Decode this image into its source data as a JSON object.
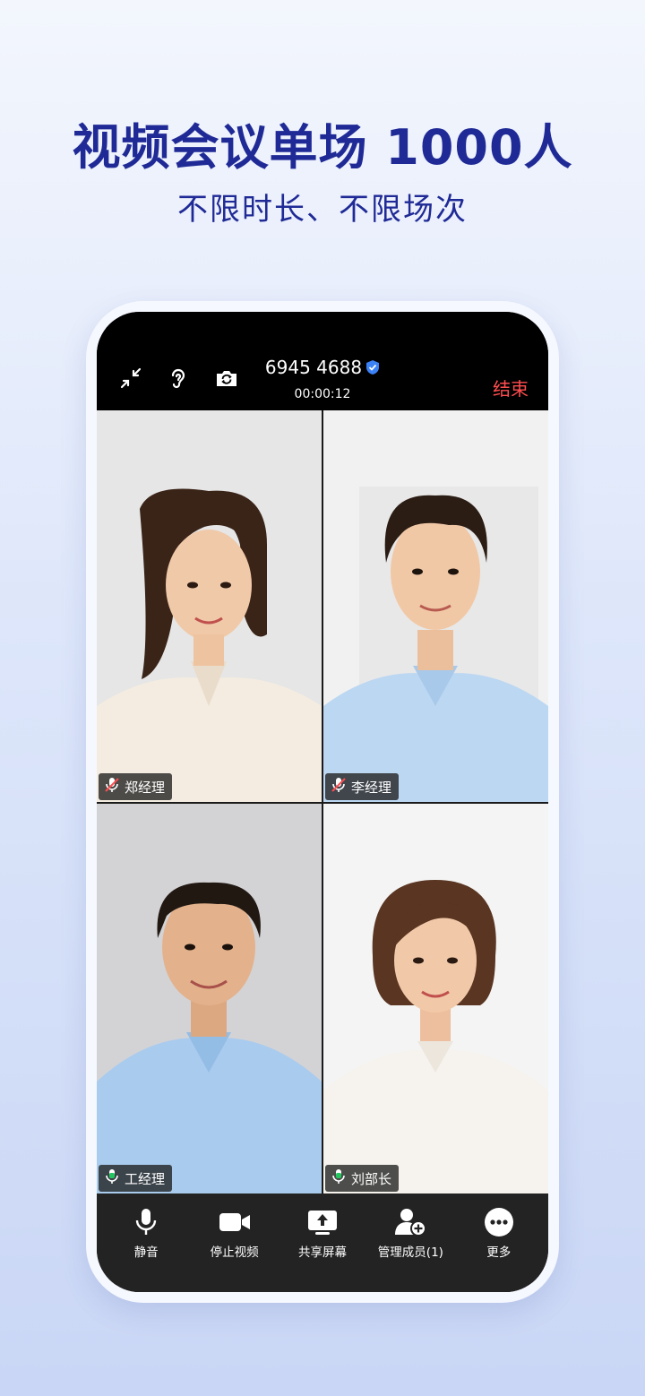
{
  "headline": "视频会议单场 1000人",
  "subline": "不限时长、不限场次",
  "meeting": {
    "id": "6945 4688",
    "timer": "00:00:12",
    "end_label": "结束"
  },
  "icons": {
    "minimize": "minimize-arrows-icon",
    "earpiece": "ear-icon",
    "camera_switch": "camera-switch-icon",
    "verified": "verified-shield-icon"
  },
  "participants": [
    {
      "name": "郑经理",
      "muted": true
    },
    {
      "name": "李经理",
      "muted": true
    },
    {
      "name": "工经理",
      "muted": false
    },
    {
      "name": "刘部长",
      "muted": false
    }
  ],
  "controls": [
    {
      "label": "静音",
      "icon": "microphone-icon"
    },
    {
      "label": "停止视频",
      "icon": "video-camera-icon"
    },
    {
      "label": "共享屏幕",
      "icon": "share-screen-icon"
    },
    {
      "label": "管理成员(1)",
      "icon": "manage-members-icon"
    },
    {
      "label": "更多",
      "icon": "more-icon"
    }
  ],
  "colors": {
    "brand_text": "#1f2a96",
    "end": "#ff4d4f",
    "mic_active": "#22c55e",
    "mic_muted": "#ff4d4f",
    "verified": "#3b82f6"
  }
}
